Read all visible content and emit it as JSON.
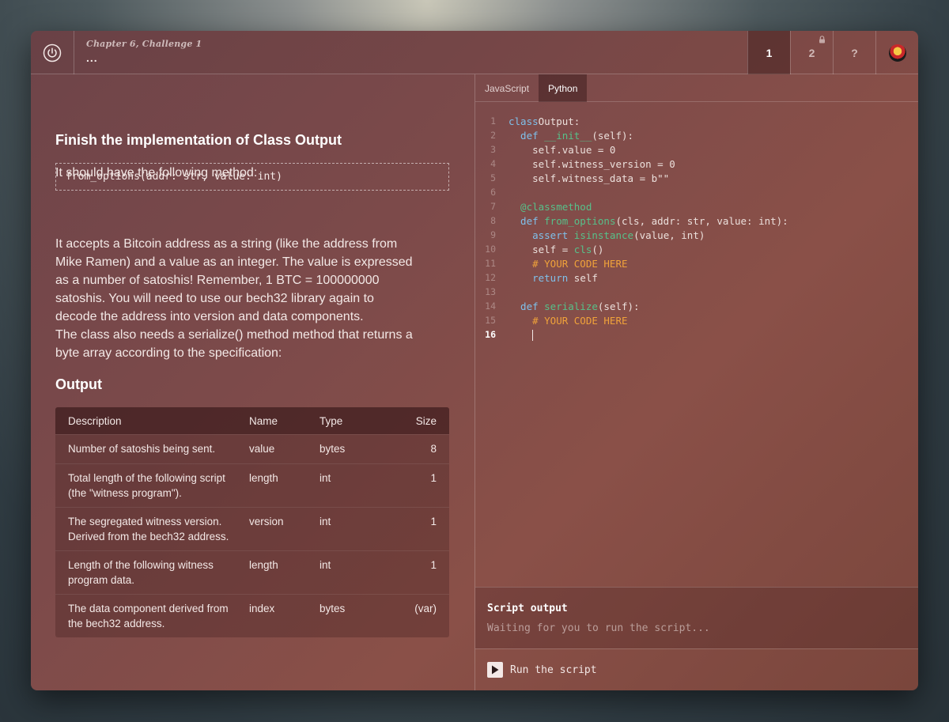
{
  "header": {
    "chapter": "Chapter 6, Challenge 1",
    "subtitle": "...",
    "tabs": [
      {
        "label": "1",
        "active": true,
        "locked": false
      },
      {
        "label": "2",
        "active": false,
        "locked": true
      },
      {
        "label": "?",
        "active": false,
        "locked": false
      }
    ],
    "icons": {
      "power": "power-icon",
      "lock": "lock-icon",
      "avatar": "avatar"
    }
  },
  "lesson": {
    "heading": "Finish the implementation of Class Output",
    "intro": "It should have the following method:",
    "method_signature": "from_options(addr: str, value: int)",
    "desc_line1": "It accepts a Bitcoin address as a string (like the address from",
    "desc_line2": "Mike Ramen) and a value as an integer. The value is expressed",
    "desc_line3": "as a number of satoshis! Remember, 1 BTC = 100000000",
    "desc_line4": "satoshis. You will need to use our bech32 library again to",
    "desc_line5": "decode the address into version and data components.",
    "desc_line6": "The class also needs a serialize() method method that returns a",
    "desc_line7": "byte array according to the specification:",
    "output_heading": "Output",
    "table": {
      "headers": [
        "Description",
        "Name",
        "Type",
        "Size"
      ],
      "rows": [
        {
          "desc1": "Number of satoshis being sent.",
          "desc2": "",
          "name": "value",
          "type": "bytes",
          "size": "8"
        },
        {
          "desc1": "Total length of the following script",
          "desc2": "(the \"witness program\").",
          "name": "length",
          "type": "int",
          "size": "1"
        },
        {
          "desc1": "The segregated witness version.",
          "desc2": "Derived from the bech32 address.",
          "name": "version",
          "type": "int",
          "size": "1"
        },
        {
          "desc1": "Length of the following witness",
          "desc2": "program data.",
          "name": "length",
          "type": "int",
          "size": "1"
        },
        {
          "desc1": "The data component derived from",
          "desc2": "the bech32 address.",
          "name": "index",
          "type": "bytes",
          "size": "(var)"
        }
      ]
    }
  },
  "editor": {
    "languages": [
      {
        "label": "JavaScript",
        "active": false
      },
      {
        "label": "Python",
        "active": true
      }
    ],
    "current_line": 16,
    "lines": [
      [
        [
          "kw",
          "class"
        ],
        [
          "",
          "Output:"
        ]
      ],
      [
        [
          "kw",
          "  def "
        ],
        [
          "fn",
          "__init__"
        ],
        [
          "",
          "(self):"
        ]
      ],
      [
        [
          "",
          "    self.value = 0"
        ]
      ],
      [
        [
          "",
          "    self.witness_version = 0"
        ]
      ],
      [
        [
          "",
          "    self.witness_data = b\"\""
        ]
      ],
      [],
      [
        [
          "deco",
          "  @classmethod"
        ]
      ],
      [
        [
          "kw",
          "  def "
        ],
        [
          "fn",
          "from_options"
        ],
        [
          "",
          "(cls, addr: str, value: int):"
        ]
      ],
      [
        [
          "kw",
          "    assert "
        ],
        [
          "fn",
          "isinstance"
        ],
        [
          "",
          "(value, int)"
        ]
      ],
      [
        [
          "",
          "    self = "
        ],
        [
          "fn",
          "cls"
        ],
        [
          "",
          "()"
        ]
      ],
      [
        [
          "cm",
          "    # YOUR CODE HERE"
        ]
      ],
      [
        [
          "kw",
          "    return "
        ],
        [
          "",
          "self"
        ]
      ],
      [],
      [
        [
          "kw",
          "  def "
        ],
        [
          "fn",
          "serialize"
        ],
        [
          "",
          "(self):"
        ]
      ],
      [
        [
          "cm",
          "    # YOUR CODE HERE"
        ]
      ],
      [
        [
          "",
          "    "
        ],
        [
          "caret",
          ""
        ]
      ]
    ]
  },
  "output": {
    "title": "Script output",
    "placeholder": "Waiting for you to run the script..."
  },
  "run": {
    "label": "Run the script",
    "icon": "play-icon"
  }
}
